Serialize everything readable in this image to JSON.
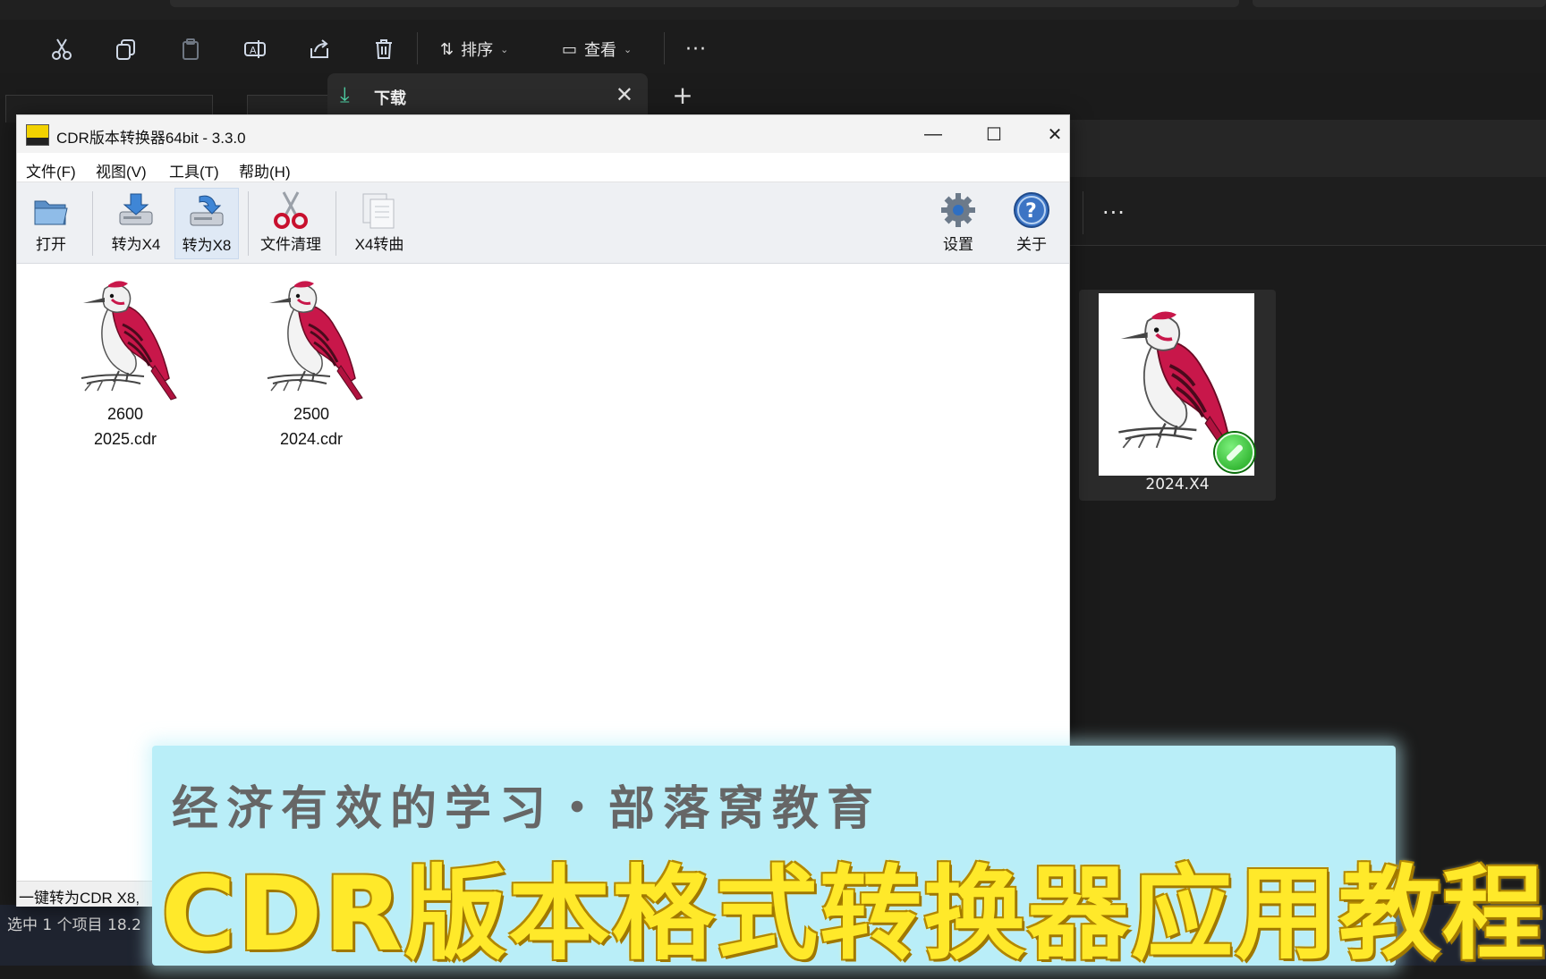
{
  "explorer": {
    "toolbar": {
      "sort_label": "排序",
      "view_label": "查看",
      "more_label": "···"
    },
    "tab": {
      "title": "下载",
      "close_glyph": "✕",
      "new_tab_glyph": "+"
    },
    "right_more_label": "···",
    "thumbnail": {
      "label": "2024.X4"
    },
    "status": "选中 1 个项目   18.2"
  },
  "app": {
    "title": "CDR版本转换器64bit - 3.3.0",
    "window_controls": {
      "minimize": "—",
      "maximize": "☐",
      "close": "✕"
    },
    "menu": [
      {
        "label": "文件(F)"
      },
      {
        "label": "视图(V)"
      },
      {
        "label": "工具(T)"
      },
      {
        "label": "帮助(H)"
      }
    ],
    "ribbon": {
      "open": "打开",
      "to_x4": "转为X4",
      "to_x8": "转为X8",
      "clean": "文件清理",
      "x4_curve": "X4转曲",
      "settings": "设置",
      "about": "关于"
    },
    "files": [
      {
        "line1": "2600",
        "line2": "2025.cdr"
      },
      {
        "line1": "2500",
        "line2": "2024.cdr"
      }
    ],
    "status": "一键转为CDR X8,"
  },
  "banner": {
    "subtitle": "经济有效的学习・部落窝教育",
    "title": "CDR版本格式转换器应用教程"
  },
  "colors": {
    "banner_bg": "#b9eef8",
    "banner_title": "#ffe92a",
    "bird_red": "#c8174a",
    "explorer_bg": "#1b1b1b"
  }
}
